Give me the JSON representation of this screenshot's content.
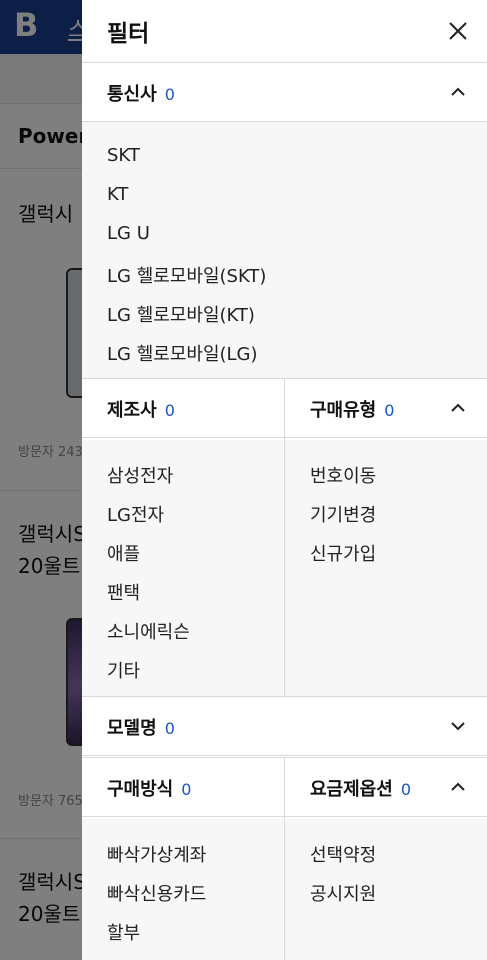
{
  "background": {
    "logo": "B",
    "nav_text": "스",
    "section_title": "Power",
    "products": [
      {
        "name": "갤럭시",
        "visitors": "방문자 243"
      },
      {
        "name": "갤럭시S\n20울트",
        "visitors": "방문자 765"
      },
      {
        "name": "갤럭시S\n20울트"
      }
    ]
  },
  "filter": {
    "title": "필터",
    "close_label": "X",
    "carrier": {
      "label": "통신사",
      "count": "0",
      "options": [
        "SKT",
        "KT",
        "LG U",
        "LG 헬로모바일(SKT)",
        "LG 헬로모바일(KT)",
        "LG 헬로모바일(LG)"
      ]
    },
    "manufacturer": {
      "label": "제조사",
      "count": "0",
      "options": [
        "삼성전자",
        "LG전자",
        "애플",
        "팬택",
        "소니에릭슨",
        "기타"
      ]
    },
    "purchase_type": {
      "label": "구매유형",
      "count": "0",
      "options": [
        "번호이동",
        "기기변경",
        "신규가입"
      ]
    },
    "model": {
      "label": "모델명",
      "count": "0"
    },
    "payment": {
      "label": "구매방식",
      "count": "0",
      "options": [
        "빠삭가상계좌",
        "빠삭신용카드",
        "할부"
      ]
    },
    "plan": {
      "label": "요금제옵션",
      "count": "0",
      "options": [
        "선택약정",
        "공시지원"
      ]
    }
  },
  "colors": {
    "accent": "#1a56c6",
    "header_bg": "#1b3f8f"
  },
  "icons": [
    "close-icon",
    "chevron-up-icon",
    "chevron-down-icon"
  ]
}
